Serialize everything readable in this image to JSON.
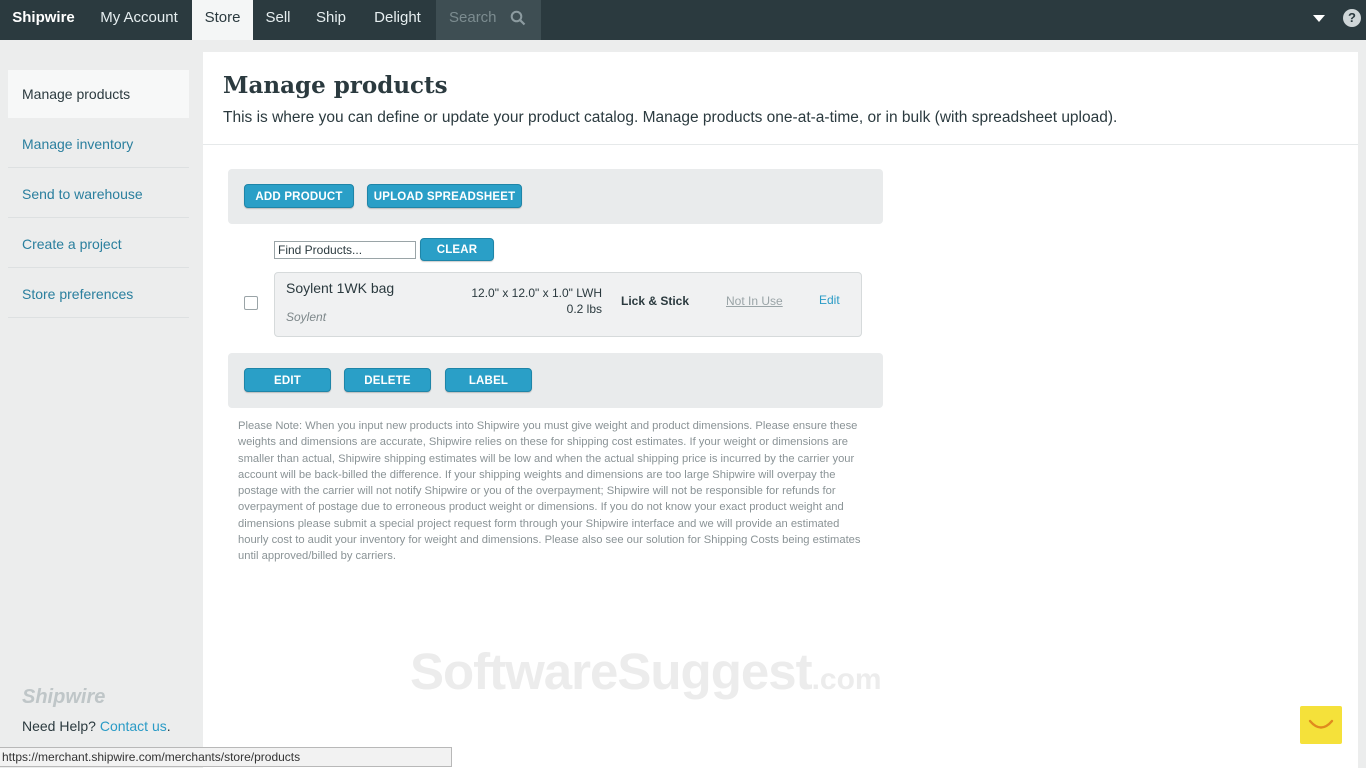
{
  "nav": {
    "brand": "Shipwire",
    "items": [
      "My Account",
      "Store",
      "Sell",
      "Ship",
      "Delight"
    ],
    "search_placeholder": "Search",
    "help": "?"
  },
  "sidebar": {
    "items": [
      "Manage products",
      "Manage inventory",
      "Send to warehouse",
      "Create a project",
      "Store preferences"
    ],
    "logo": "Shipwire",
    "help_prefix": "Need Help?",
    "help_link": "Contact us",
    "help_suffix": "."
  },
  "main": {
    "title": "Manage products",
    "subtitle": "This is where you can define or update your product catalog. Manage products one-at-a-time, or in bulk (with spreadsheet upload).",
    "buttons": {
      "add": "ADD PRODUCT",
      "upload": "UPLOAD SPREADSHEET",
      "clear": "CLEAR",
      "edit": "EDIT",
      "delete": "DELETE",
      "label": "LABEL"
    },
    "find_value": "Find Products...",
    "product": {
      "name": "Soylent 1WK bag",
      "brand": "Soylent",
      "dimensions": "12.0\" x 12.0\" x 1.0\" LWH",
      "weight": "0.2 lbs",
      "packaging": "Lick & Stick",
      "status": "Not In Use",
      "edit": "Edit"
    },
    "note": "Please Note: When you input new products into Shipwire you must give weight and product dimensions. Please ensure these weights and dimensions are accurate, Shipwire relies on these for shipping cost estimates. If your weight or dimensions are smaller than actual, Shipwire shipping estimates will be low and when the actual shipping price is incurred by the carrier your account will be back-billed the difference. If your shipping weights and dimensions are too large Shipwire will overpay the postage with the carrier will not notify Shipwire or you of the overpayment; Shipwire will not be responsible for refunds for overpayment of postage due to erroneous product weight or dimensions. If you do not know your exact product weight and dimensions please submit a special project request form through your Shipwire interface and we will provide an estimated hourly cost to audit your inventory for weight and dimensions. Please also see our solution for Shipping Costs being estimates until approved/billed by carriers."
  },
  "watermark": {
    "main": "SoftwareSuggest",
    "suffix": ".com"
  },
  "statusbar": "https://merchant.shipwire.com/merchants/store/products",
  "colors": {
    "topbar": "#2b3a3f",
    "accent": "#2a9fc7",
    "link": "#2a9bc6",
    "chat": "#f5e13a"
  }
}
